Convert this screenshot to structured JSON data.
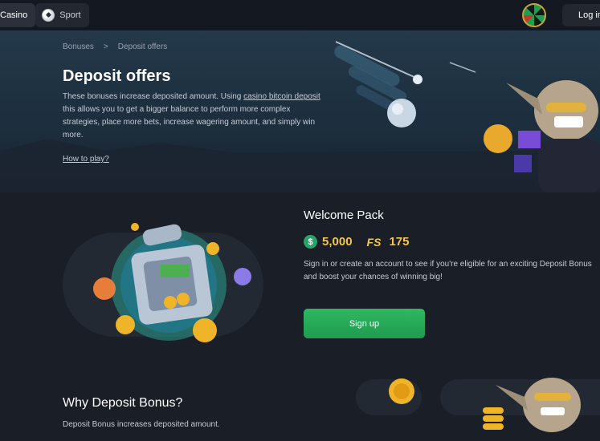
{
  "topbar": {
    "tabs": [
      {
        "label": "Casino",
        "icon": "casino-icon"
      },
      {
        "label": "Sport",
        "icon": "soccer-ball-icon"
      }
    ],
    "wheel_icon": "fortune-wheel-icon",
    "login_label": "Log in"
  },
  "hero": {
    "breadcrumb": [
      "Bonuses",
      ">",
      "Deposit offers"
    ],
    "title": "Deposit offers",
    "desc_part1": "These bonuses increase deposited amount. Using ",
    "desc_link": "casino bitcoin deposit",
    "desc_part2": " this allows you to get a bigger balance to perform more complex strategies, place more bets, increase wagering amount, and simply win more.",
    "how_to_play": "How to play?"
  },
  "welcome": {
    "title": "Welcome Pack",
    "money_amount": "5,000",
    "money_icon": "dollar-coin-icon",
    "fs_label": "FS",
    "fs_amount": "175",
    "description": "Sign in or create an account to see if you're eligible for an exciting Deposit Bonus and boost your chances of winning big!",
    "signup_label": "Sign up"
  },
  "why": {
    "title": "Why Deposit Bonus?",
    "description": "Deposit Bonus increases deposited amount."
  },
  "colors": {
    "background": "#1a1e26",
    "topbar": "#141820",
    "accent_green": "#2fb862",
    "gold": "#f1c84b"
  }
}
